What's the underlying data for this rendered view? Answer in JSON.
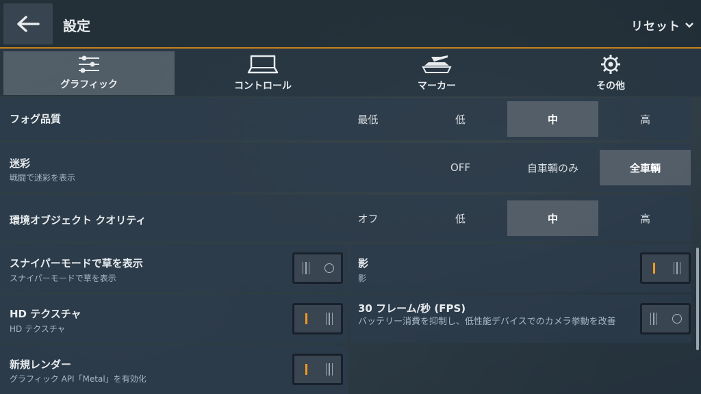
{
  "header": {
    "title": "設定",
    "reset_label": "リセット"
  },
  "tabs": [
    {
      "label": "グラフィック",
      "icon": "sliders-icon",
      "active": true
    },
    {
      "label": "コントロール",
      "icon": "gamepad-icon",
      "active": false
    },
    {
      "label": "マーカー",
      "icon": "tank-icon",
      "active": false
    },
    {
      "label": "その他",
      "icon": "gear-icon",
      "active": false
    }
  ],
  "settings": {
    "fog": {
      "label": "フォグ品質",
      "options": [
        "最低",
        "低",
        "中",
        "高"
      ],
      "selected": "中"
    },
    "camo": {
      "label": "迷彩",
      "sub": "戦闘で迷彩を表示",
      "options": [
        "OFF",
        "自車輌のみ",
        "全車輌"
      ],
      "selected": "全車輌"
    },
    "env": {
      "label": "環境オブジェクト クオリティ",
      "options": [
        "オフ",
        "低",
        "中",
        "高"
      ],
      "selected": "中"
    },
    "sniper_grass": {
      "label": "スナイパーモードで草を表示",
      "sub": "スナイパーモードで草を表示",
      "on": false
    },
    "shadow": {
      "label": "影",
      "sub": "影",
      "on": true
    },
    "hd_texture": {
      "label": "HD テクスチャ",
      "sub": "HD テクスチャ",
      "on": true
    },
    "fps30": {
      "label": "30 フレーム/秒 (FPS)",
      "sub": "バッテリー消費を抑制し、低性能デバイスでのカメラ挙動を改善",
      "on": false
    },
    "new_render": {
      "label": "新規レンダー",
      "sub": "グラフィック API「Metal」を有効化",
      "on": true
    }
  },
  "colors": {
    "accent": "#f19a1e",
    "header_line": "#c8821c"
  }
}
